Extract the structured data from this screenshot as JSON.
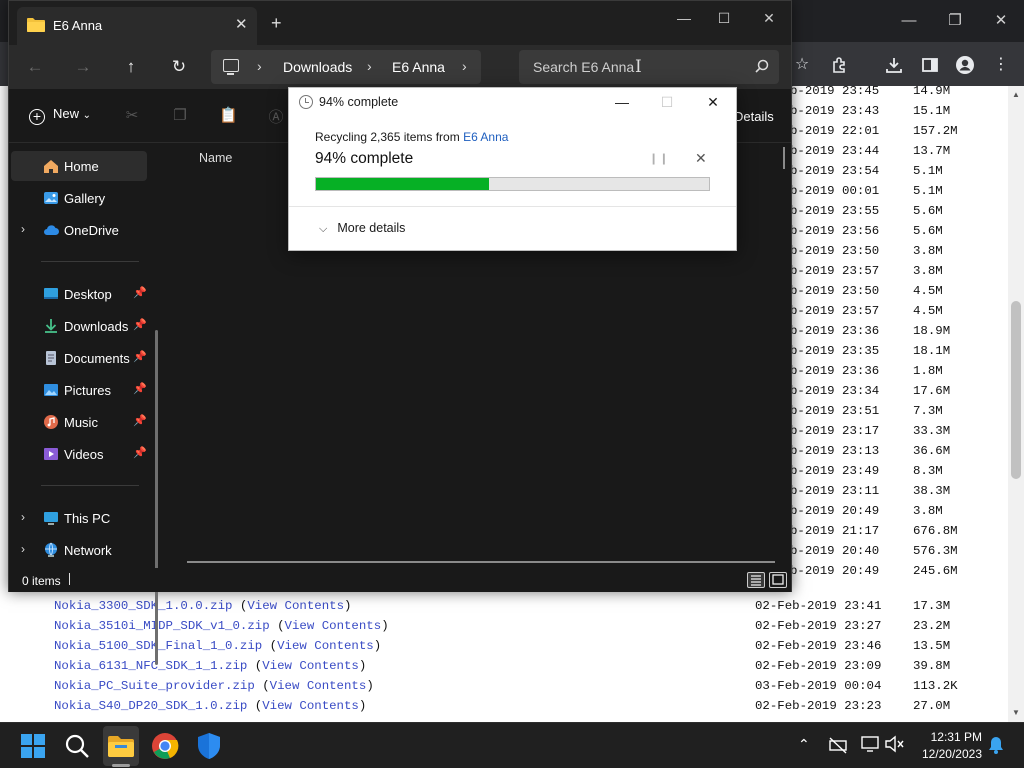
{
  "browser": {
    "listing_partial": [
      {
        "date": "b-2019 23:45",
        "size": "14.9M"
      },
      {
        "date": "b-2019 23:43",
        "size": "15.1M"
      },
      {
        "date": "b-2019 22:01",
        "size": "157.2M"
      },
      {
        "date": "b-2019 23:44",
        "size": "13.7M"
      },
      {
        "date": "b-2019 23:54",
        "size": "5.1M"
      },
      {
        "date": "b-2019 00:01",
        "size": "5.1M"
      },
      {
        "date": "b-2019 23:55",
        "size": "5.6M"
      },
      {
        "date": "b-2019 23:56",
        "size": "5.6M"
      },
      {
        "date": "b-2019 23:50",
        "size": "3.8M"
      },
      {
        "date": "b-2019 23:57",
        "size": "3.8M"
      },
      {
        "date": "b-2019 23:50",
        "size": "4.5M"
      },
      {
        "date": "b-2019 23:57",
        "size": "4.5M"
      },
      {
        "date": "b-2019 23:36",
        "size": "18.9M"
      },
      {
        "date": "b-2019 23:35",
        "size": "18.1M"
      },
      {
        "date": "b-2019 23:36",
        "size": "1.8M"
      },
      {
        "date": "b-2019 23:34",
        "size": "17.6M"
      },
      {
        "date": "b-2019 23:51",
        "size": "7.3M"
      },
      {
        "date": "b-2019 23:17",
        "size": "33.3M"
      },
      {
        "date": "b-2019 23:13",
        "size": "36.6M"
      },
      {
        "date": "b-2019 23:49",
        "size": "8.3M"
      },
      {
        "date": "b-2019 23:11",
        "size": "38.3M"
      },
      {
        "date": "b-2019 20:49",
        "size": "3.8M"
      },
      {
        "date": "b-2019 21:17",
        "size": "676.8M"
      },
      {
        "date": "b-2019 20:40",
        "size": "576.3M"
      },
      {
        "date": "b-2019 20:49",
        "size": "245.6M"
      }
    ],
    "listing_full": [
      {
        "file": "Nokia_3300_SDK_1.0.0.zip",
        "view": "View Contents",
        "date": "02-Feb-2019 23:41",
        "size": "17.3M"
      },
      {
        "file": "Nokia_3510i_MIDP_SDK_v1_0.zip",
        "view": "View Contents",
        "date": "02-Feb-2019 23:27",
        "size": "23.2M"
      },
      {
        "file": "Nokia_5100_SDK_Final_1_0.zip",
        "view": "View Contents",
        "date": "02-Feb-2019 23:46",
        "size": "13.5M"
      },
      {
        "file": "Nokia_6131_NFC_SDK_1_1.zip",
        "view": "View Contents",
        "date": "02-Feb-2019 23:09",
        "size": "39.8M"
      },
      {
        "file": "Nokia_PC_Suite_provider.zip",
        "view": "View Contents",
        "date": "03-Feb-2019 00:04",
        "size": "113.2K"
      },
      {
        "file": "Nokia_S40_DP20_SDK_1.0.zip",
        "view": "View Contents",
        "date": "02-Feb-2019 23:23",
        "size": "27.0M"
      }
    ]
  },
  "explorer": {
    "tab_title": "E6 Anna",
    "breadcrumb": [
      "Downloads",
      "E6 Anna"
    ],
    "search_placeholder": "Search E6 Anna",
    "new_label": "New",
    "details_label": "Details",
    "column_name": "Name",
    "status": "0 items",
    "sidebar": {
      "home": "Home",
      "gallery": "Gallery",
      "onedrive": "OneDrive",
      "desktop": "Desktop",
      "downloads": "Downloads",
      "documents": "Documents",
      "pictures": "Pictures",
      "music": "Music",
      "videos": "Videos",
      "thispc": "This PC",
      "network": "Network"
    }
  },
  "dialog": {
    "title": "94% complete",
    "recycling_prefix": "Recycling 2,365 items from ",
    "recycling_source": "E6 Anna",
    "percent_text": "94% complete",
    "progress": 0.44,
    "more_details": "More details",
    "fill_color": "#06b025"
  },
  "taskbar": {
    "time": "12:31 PM",
    "date": "12/20/2023"
  }
}
